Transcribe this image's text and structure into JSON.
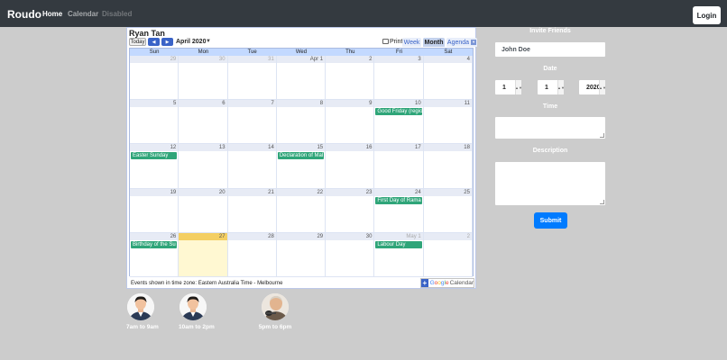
{
  "navbar": {
    "brand": "Roudo",
    "links": [
      "Home",
      "Calendar",
      "Disabled"
    ],
    "login_label": "Login"
  },
  "calendar": {
    "owner": "Ryan Tan",
    "today_label": "Today",
    "prev_icon": "chevron-left-icon",
    "next_icon": "chevron-right-icon",
    "month_label": "April 2020",
    "print_label": "Print",
    "views": [
      "Week",
      "Month",
      "Agenda"
    ],
    "active_view": "Month",
    "days_of_week": [
      "Sun",
      "Mon",
      "Tue",
      "Wed",
      "Thu",
      "Fri",
      "Sat"
    ],
    "weeks": [
      [
        {
          "d": "29",
          "o": true
        },
        {
          "d": "30",
          "o": true
        },
        {
          "d": "31",
          "o": true
        },
        {
          "d": "Apr 1"
        },
        {
          "d": "2"
        },
        {
          "d": "3"
        },
        {
          "d": "4"
        }
      ],
      [
        {
          "d": "5"
        },
        {
          "d": "6"
        },
        {
          "d": "7"
        },
        {
          "d": "8"
        },
        {
          "d": "9"
        },
        {
          "d": "10",
          "e": "Good Friday (regio"
        },
        {
          "d": "11"
        }
      ],
      [
        {
          "d": "12",
          "e": "Easter Sunday"
        },
        {
          "d": "13"
        },
        {
          "d": "14"
        },
        {
          "d": "15",
          "e": "Declaration of Mal"
        },
        {
          "d": "16"
        },
        {
          "d": "17"
        },
        {
          "d": "18"
        }
      ],
      [
        {
          "d": "19"
        },
        {
          "d": "20"
        },
        {
          "d": "21"
        },
        {
          "d": "22"
        },
        {
          "d": "23"
        },
        {
          "d": "24",
          "e": "First Day of Rama"
        },
        {
          "d": "25"
        }
      ],
      [
        {
          "d": "26",
          "e": "Birthday of the Su"
        },
        {
          "d": "27",
          "today": true
        },
        {
          "d": "28"
        },
        {
          "d": "29"
        },
        {
          "d": "30"
        },
        {
          "d": "May 1",
          "o": true,
          "e": "Labour Day"
        },
        {
          "d": "2",
          "o": true
        }
      ]
    ],
    "timezone_note": "Events shown in time zone: Eastern Australia Time - Melbourne",
    "badge": {
      "g": "G",
      "o1": "o",
      "o2": "o",
      "g2": "g",
      "l": "l",
      "e": "e",
      "word": "Calendar"
    }
  },
  "avatars": [
    {
      "label": "7am to 9am"
    },
    {
      "label": "10am to 2pm"
    },
    {
      "label": "5pm to 6pm"
    }
  ],
  "form": {
    "invite_label": "Invite Friends",
    "invite_value": "John Doe",
    "date_label": "Date",
    "day_value": "1",
    "month_value": "1",
    "year_value": "2020",
    "time_label": "Time",
    "description_label": "Description",
    "submit_label": "Submit"
  },
  "colors": {
    "navbar": "#343a40",
    "page_background": "#cccccc",
    "event": "#2fa579",
    "today_highlight": "#f4cf63",
    "submit": "#007bff"
  }
}
